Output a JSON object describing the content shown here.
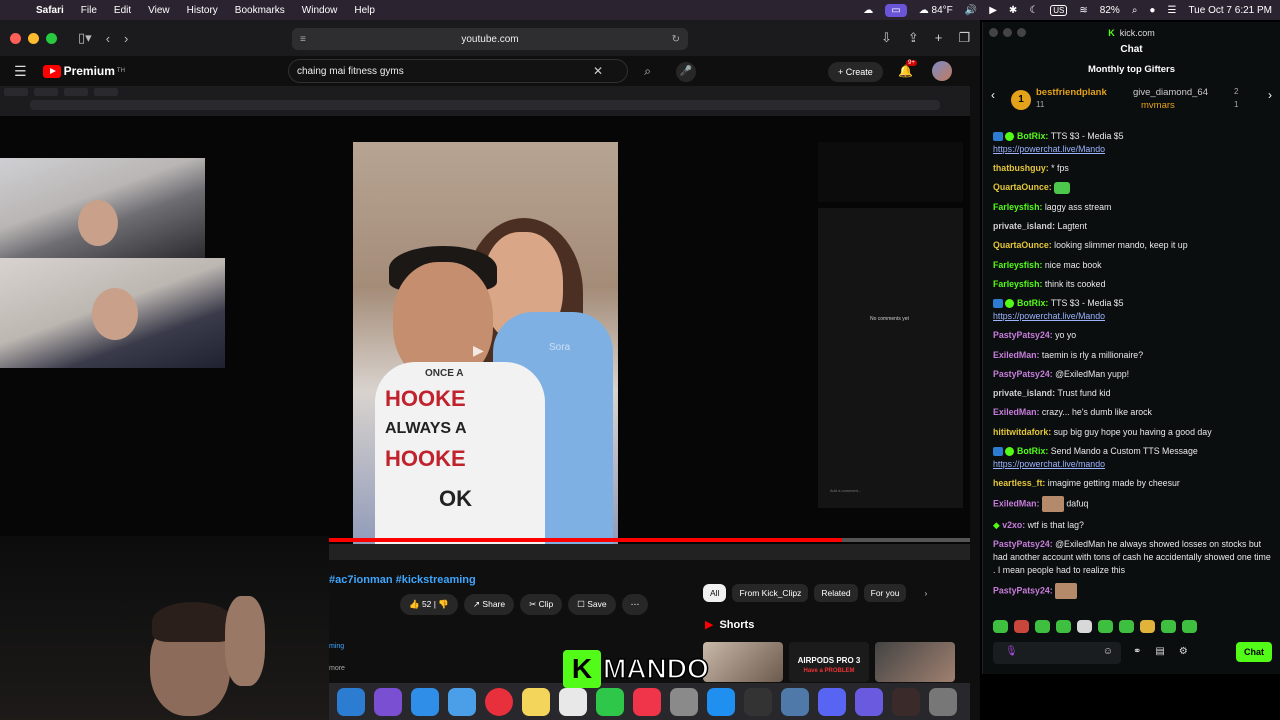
{
  "menubar": {
    "app": "Safari",
    "items": [
      "File",
      "Edit",
      "View",
      "History",
      "Bookmarks",
      "Window",
      "Help"
    ],
    "weather": "84°F",
    "battery": "82%",
    "kbd": "US",
    "datetime": "Tue Oct 7  6:21 PM"
  },
  "safari": {
    "url": "youtube.com"
  },
  "youtube": {
    "logo": "Premium",
    "logo_sup": "TH",
    "search_value": "chaing mai fitness gyms",
    "create_label": "+ Create",
    "notif_count": "9+",
    "hashtags": "#ac7ionman #kickstreaming",
    "likes": "52",
    "share": "Share",
    "clip": "Clip",
    "save": "Save",
    "desc1": "ming",
    "desc2": "more",
    "chips": [
      "All",
      "From Kick_Clipz",
      "Related",
      "For you"
    ],
    "shorts_label": "Shorts",
    "short_thumb_text": "AIRPODS PRO 3",
    "short_thumb_sub": "Have a PROBLEM"
  },
  "tiktok": {
    "no_comments": "No comments yet",
    "add_comment": "Add a comment...",
    "shirt_line1": "ONCE A",
    "shirt_line2": "HOOKE",
    "shirt_line3": "ALWAYS A",
    "shirt_line4": "HOOKE",
    "shirt_line5": "OK",
    "watermark": "Sora"
  },
  "overlay": {
    "brand_letter": "K",
    "name": "MANDO"
  },
  "kick": {
    "site": "kick.com",
    "title": "Chat",
    "gifters_title": "Monthly top Gifters",
    "gifter1": "bestfriendplank",
    "gifter1_count": "11",
    "gifter2": "give_diamond_64",
    "gifter2_count": "2",
    "gifter3": "mvmars",
    "gifter3_count": "1",
    "send": "Chat",
    "messages": [
      {
        "user": "BotRix:",
        "color": "#53fc18",
        "text": "TTS $3 - Media $5",
        "link": "https://powerchat.live/Mando"
      },
      {
        "user": "thatbushguy:",
        "color": "#e3c63a",
        "text": "* fps"
      },
      {
        "user": "QuartaOunce:",
        "color": "#e3c63a",
        "text": ""
      },
      {
        "user": "Farleysfish:",
        "color": "#53fc18",
        "text": "laggy ass stream"
      },
      {
        "user": "private_island:",
        "color": "#cfcfcf",
        "text": "Lagtent"
      },
      {
        "user": "QuartaOunce:",
        "color": "#e3c63a",
        "text": "looking slimmer mando, keep it up"
      },
      {
        "user": "Farleysfish:",
        "color": "#53fc18",
        "text": "nice mac book"
      },
      {
        "user": "Farleysfish:",
        "color": "#53fc18",
        "text": "think its cooked"
      },
      {
        "user": "BotRix:",
        "color": "#53fc18",
        "text": "TTS $3 - Media $5",
        "link": "https://powerchat.live/Mando"
      },
      {
        "user": "PastyPatsy24:",
        "color": "#c77ddb",
        "text": "yo yo"
      },
      {
        "user": "ExiledMan:",
        "color": "#c77ddb",
        "text": "taemin is rly a millionaire?"
      },
      {
        "user": "PastyPatsy24:",
        "color": "#c77ddb",
        "text": "@ExiledMan yupp!"
      },
      {
        "user": "private_island:",
        "color": "#cfcfcf",
        "text": "Trust fund kid"
      },
      {
        "user": "ExiledMan:",
        "color": "#c77ddb",
        "text": "crazy... he's dumb like arock"
      },
      {
        "user": "hititwitdafork:",
        "color": "#e3c63a",
        "text": "sup big guy hope you having a good day"
      },
      {
        "user": "BotRix:",
        "color": "#53fc18",
        "text": "Send Mando a Custom TTS Message",
        "link": "https://powerchat.live/mando"
      },
      {
        "user": "heartless_ft:",
        "color": "#e3c63a",
        "text": "imagime getting made by cheesur"
      },
      {
        "user": "ExiledMan:",
        "color": "#c77ddb",
        "text": "dafuq"
      },
      {
        "user": "v2xo:",
        "color": "#c77ddb",
        "text": "wtf is that lag?"
      },
      {
        "user": "PastyPatsy24:",
        "color": "#c77ddb",
        "text": "@ExiledMan he always showed losses on stocks but had another account with tons of cash he accidentally showed one time . I mean people had to realize this"
      },
      {
        "user": "PastyPatsy24:",
        "color": "#c77ddb",
        "text": ""
      }
    ]
  },
  "colors": {
    "kick_green": "#53fc18",
    "yt_red": "#ff0000",
    "link_blue": "#3ea6ff"
  }
}
